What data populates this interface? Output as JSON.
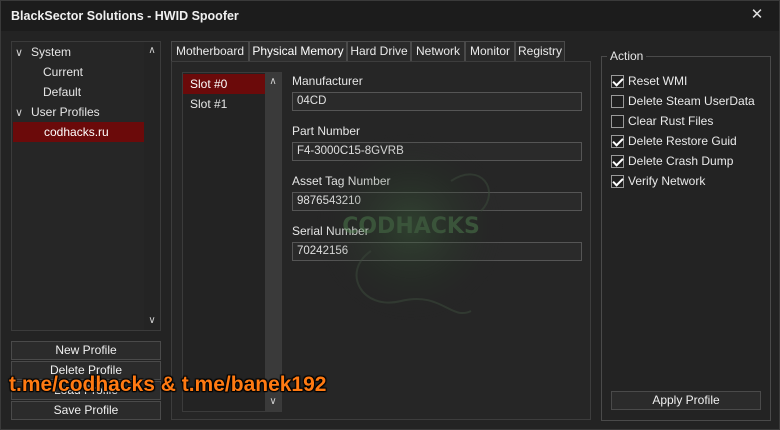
{
  "window": {
    "title": "BlackSector Solutions - HWID Spoofer",
    "close_glyph": "✕"
  },
  "tree": {
    "items": [
      {
        "label": "System",
        "level": 0,
        "expanded": true
      },
      {
        "label": "Current",
        "level": 1
      },
      {
        "label": "Default",
        "level": 1
      },
      {
        "label": "User Profiles",
        "level": 0,
        "expanded": true
      },
      {
        "label": "codhacks.ru",
        "level": 1,
        "selected": true
      }
    ]
  },
  "profile_buttons": {
    "new": "New Profile",
    "delete": "Delete Profile",
    "load": "Load Profile",
    "save": "Save Profile"
  },
  "tabs": [
    {
      "label": "Motherboard"
    },
    {
      "label": "Physical Memory",
      "active": true
    },
    {
      "label": "Hard Drive"
    },
    {
      "label": "Network"
    },
    {
      "label": "Monitor"
    },
    {
      "label": "Registry"
    }
  ],
  "slots": [
    {
      "label": "Slot #0",
      "selected": true
    },
    {
      "label": "Slot #1"
    }
  ],
  "fields": {
    "manufacturer": {
      "label": "Manufacturer",
      "value": "04CD"
    },
    "part_number": {
      "label": "Part Number",
      "value": "F4-3000C15-8GVRB"
    },
    "asset_tag": {
      "label": "Asset Tag Number",
      "value": "9876543210"
    },
    "serial_number": {
      "label": "Serial Number",
      "value": "70242156"
    }
  },
  "action": {
    "title": "Action",
    "options": [
      {
        "label": "Reset WMI",
        "checked": true
      },
      {
        "label": "Delete Steam UserData",
        "checked": false
      },
      {
        "label": "Clear Rust Files",
        "checked": false
      },
      {
        "label": "Delete Restore Guid",
        "checked": true
      },
      {
        "label": "Delete Crash Dump",
        "checked": true
      },
      {
        "label": "Verify Network",
        "checked": true
      }
    ],
    "apply_label": "Apply Profile"
  },
  "watermark_text": "CODHACKS",
  "overlay_text": "t.me/codhacks & t.me/banek192",
  "colors": {
    "selection": "#6b0a0a",
    "overlay": "#ff7a12",
    "watermark": "#2f5a2f"
  }
}
